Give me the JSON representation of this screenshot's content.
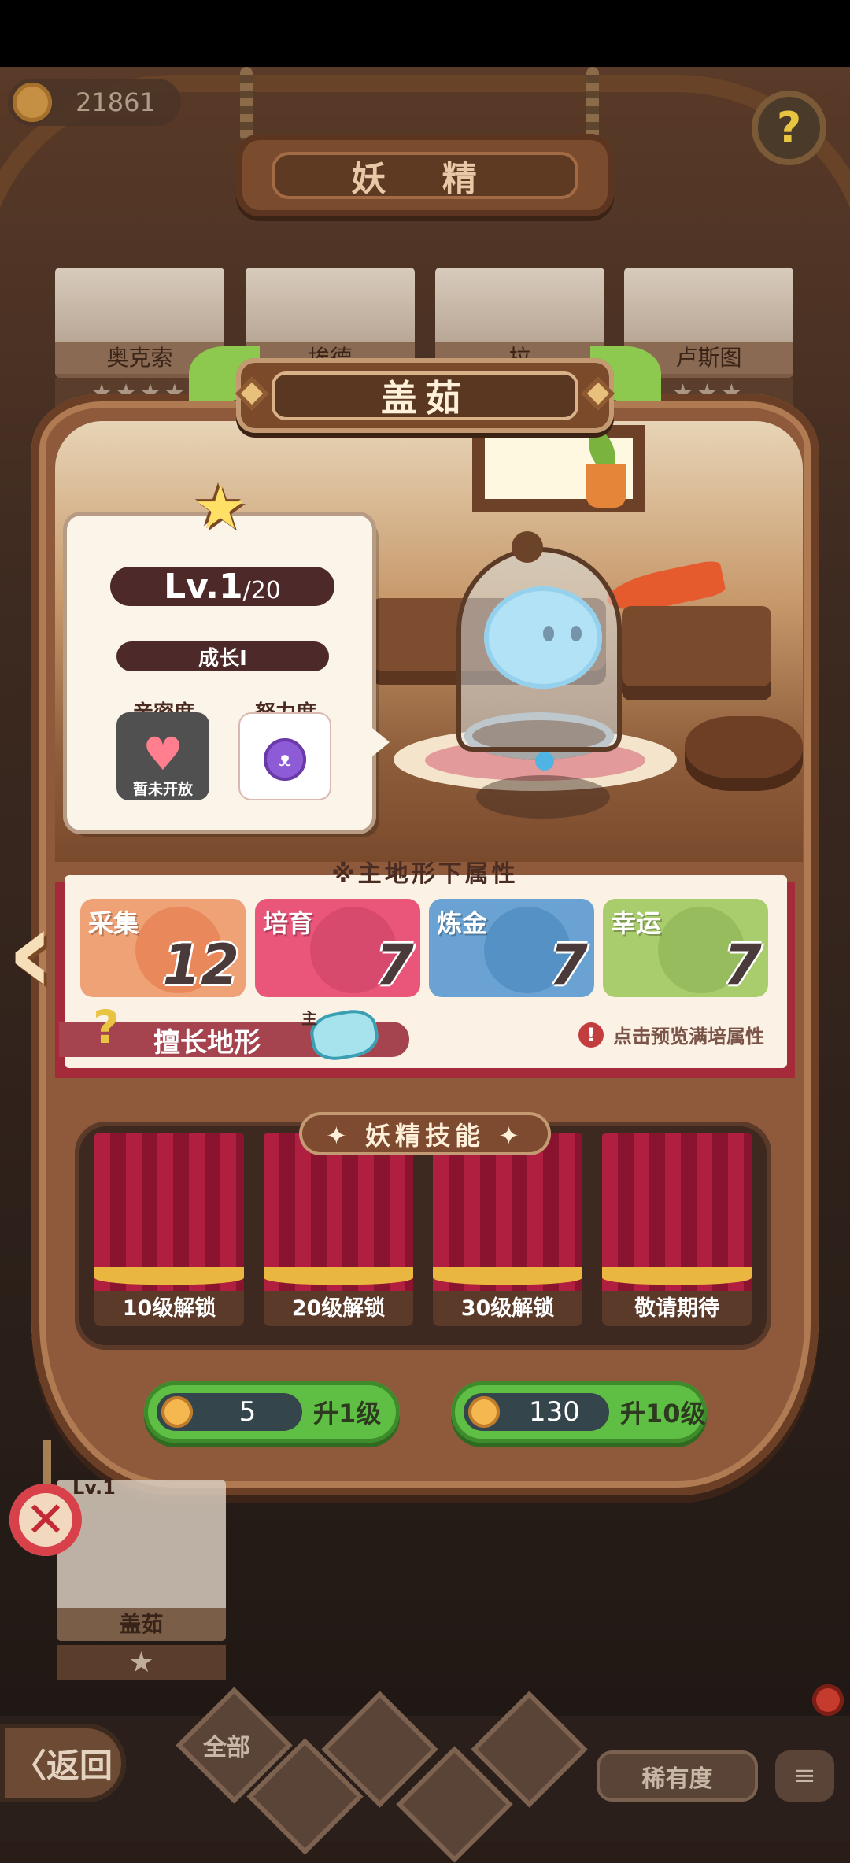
{
  "header": {
    "gold_amount": "21861",
    "title": "妖 精",
    "help_icon": "?"
  },
  "background_cards": [
    {
      "name": "奥克索",
      "stars": "★★★★"
    },
    {
      "name": "埃德",
      "stars": ""
    },
    {
      "name": "拉",
      "stars": ""
    },
    {
      "name": "卢斯图",
      "stars": "★★★"
    }
  ],
  "fairy": {
    "name": "盖茹",
    "level": "Lv.1",
    "level_max": "/20",
    "growth_stage": "成长Ⅰ",
    "intimacy_label": "亲密度",
    "intimacy_status": "暂未开放",
    "effort_label": "努力度"
  },
  "attributes": {
    "header": "※主地形下属性",
    "items": [
      {
        "name": "采集",
        "value": "12",
        "color": "#f0a277"
      },
      {
        "name": "培育",
        "value": "7",
        "color": "#e9567a"
      },
      {
        "name": "炼金",
        "value": "7",
        "color": "#6aa3d3"
      },
      {
        "name": "幸运",
        "value": "7",
        "color": "#a9cc6d"
      }
    ],
    "terrain_label": "擅长地形",
    "terrain_main_tag": "主",
    "preview_text": "点击预览满培属性"
  },
  "skills": {
    "title": "✦ 妖精技能 ✦",
    "slots": [
      "10级解锁",
      "20级解锁",
      "30级解锁",
      "敬请期待"
    ]
  },
  "upgrade": {
    "one": {
      "cost": "5",
      "label": "升1级"
    },
    "ten": {
      "cost": "130",
      "label": "升10级"
    }
  },
  "gallery_card": {
    "level": "Lv.1",
    "name": "盖茹",
    "stars": "★"
  },
  "bottom_nav": {
    "back_label": "〈返回",
    "filter_all": "全部",
    "rarity_label": "稀有度",
    "sort_icon": "≡"
  },
  "colors": {
    "panel": "#8e5a3b",
    "banner_red": "#a52a3a",
    "button_green": "#5fbf44"
  }
}
